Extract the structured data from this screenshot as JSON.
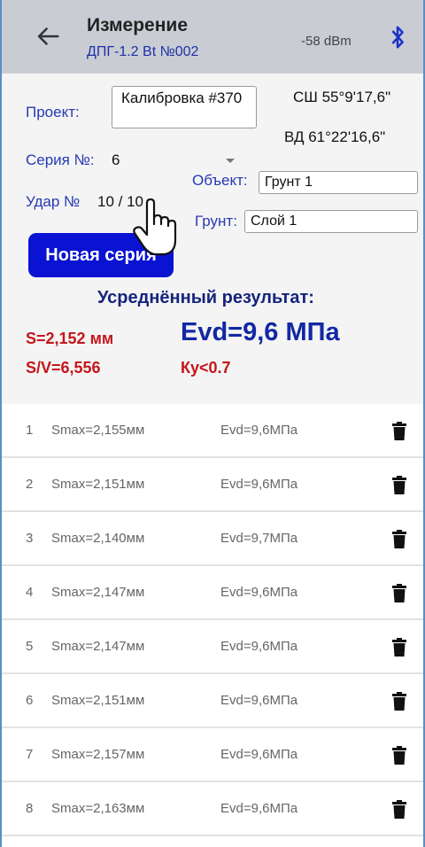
{
  "header": {
    "title": "Измерение",
    "subtitle": "ДПГ-1.2 Bt №002",
    "signal": "-58 dBm"
  },
  "form": {
    "project_label": "Проект:",
    "project_value": "Калибровка #370",
    "lat": "СШ 55°9'17,6\"",
    "lon": "ВД 61°22'16,6\"",
    "series_label": "Серия №:",
    "series_value": "6",
    "object_label": "Объект:",
    "object_value": "Грунт 1",
    "hit_label": "Удар №",
    "hit_value": "10 / 10",
    "soil_label": "Грунт:",
    "soil_value": "Слой 1",
    "new_series_button": "Новая серия"
  },
  "result": {
    "title": "Усреднённый результат:",
    "s": "S=2,152 мм",
    "sv": "S/V=6,556",
    "evd": "Evd=9,6 МПа",
    "ky": "Ку<0.7"
  },
  "measurements": [
    {
      "n": "1",
      "smax": "Smax=2,155мм",
      "evd": "Evd=9,6МПа"
    },
    {
      "n": "2",
      "smax": "Smax=2,151мм",
      "evd": "Evd=9,6МПа"
    },
    {
      "n": "3",
      "smax": "Smax=2,140мм",
      "evd": "Evd=9,7МПа"
    },
    {
      "n": "4",
      "smax": "Smax=2,147мм",
      "evd": "Evd=9,6МПа"
    },
    {
      "n": "5",
      "smax": "Smax=2,147мм",
      "evd": "Evd=9,6МПа"
    },
    {
      "n": "6",
      "smax": "Smax=2,151мм",
      "evd": "Evd=9,6МПа"
    },
    {
      "n": "7",
      "smax": "Smax=2,157мм",
      "evd": "Evd=9,6МПа"
    },
    {
      "n": "8",
      "smax": "Smax=2,163мм",
      "evd": "Evd=9,6МПа"
    }
  ],
  "icons": {
    "back": "arrow-left-icon",
    "bluetooth": "bluetooth-icon",
    "delete": "trash-icon",
    "cursor": "hand-pointer-icon"
  },
  "colors": {
    "appbar": "#c9cdd3",
    "primary_blue": "#0a13d2",
    "dark_blue": "#16257c",
    "red": "#c4161c"
  }
}
